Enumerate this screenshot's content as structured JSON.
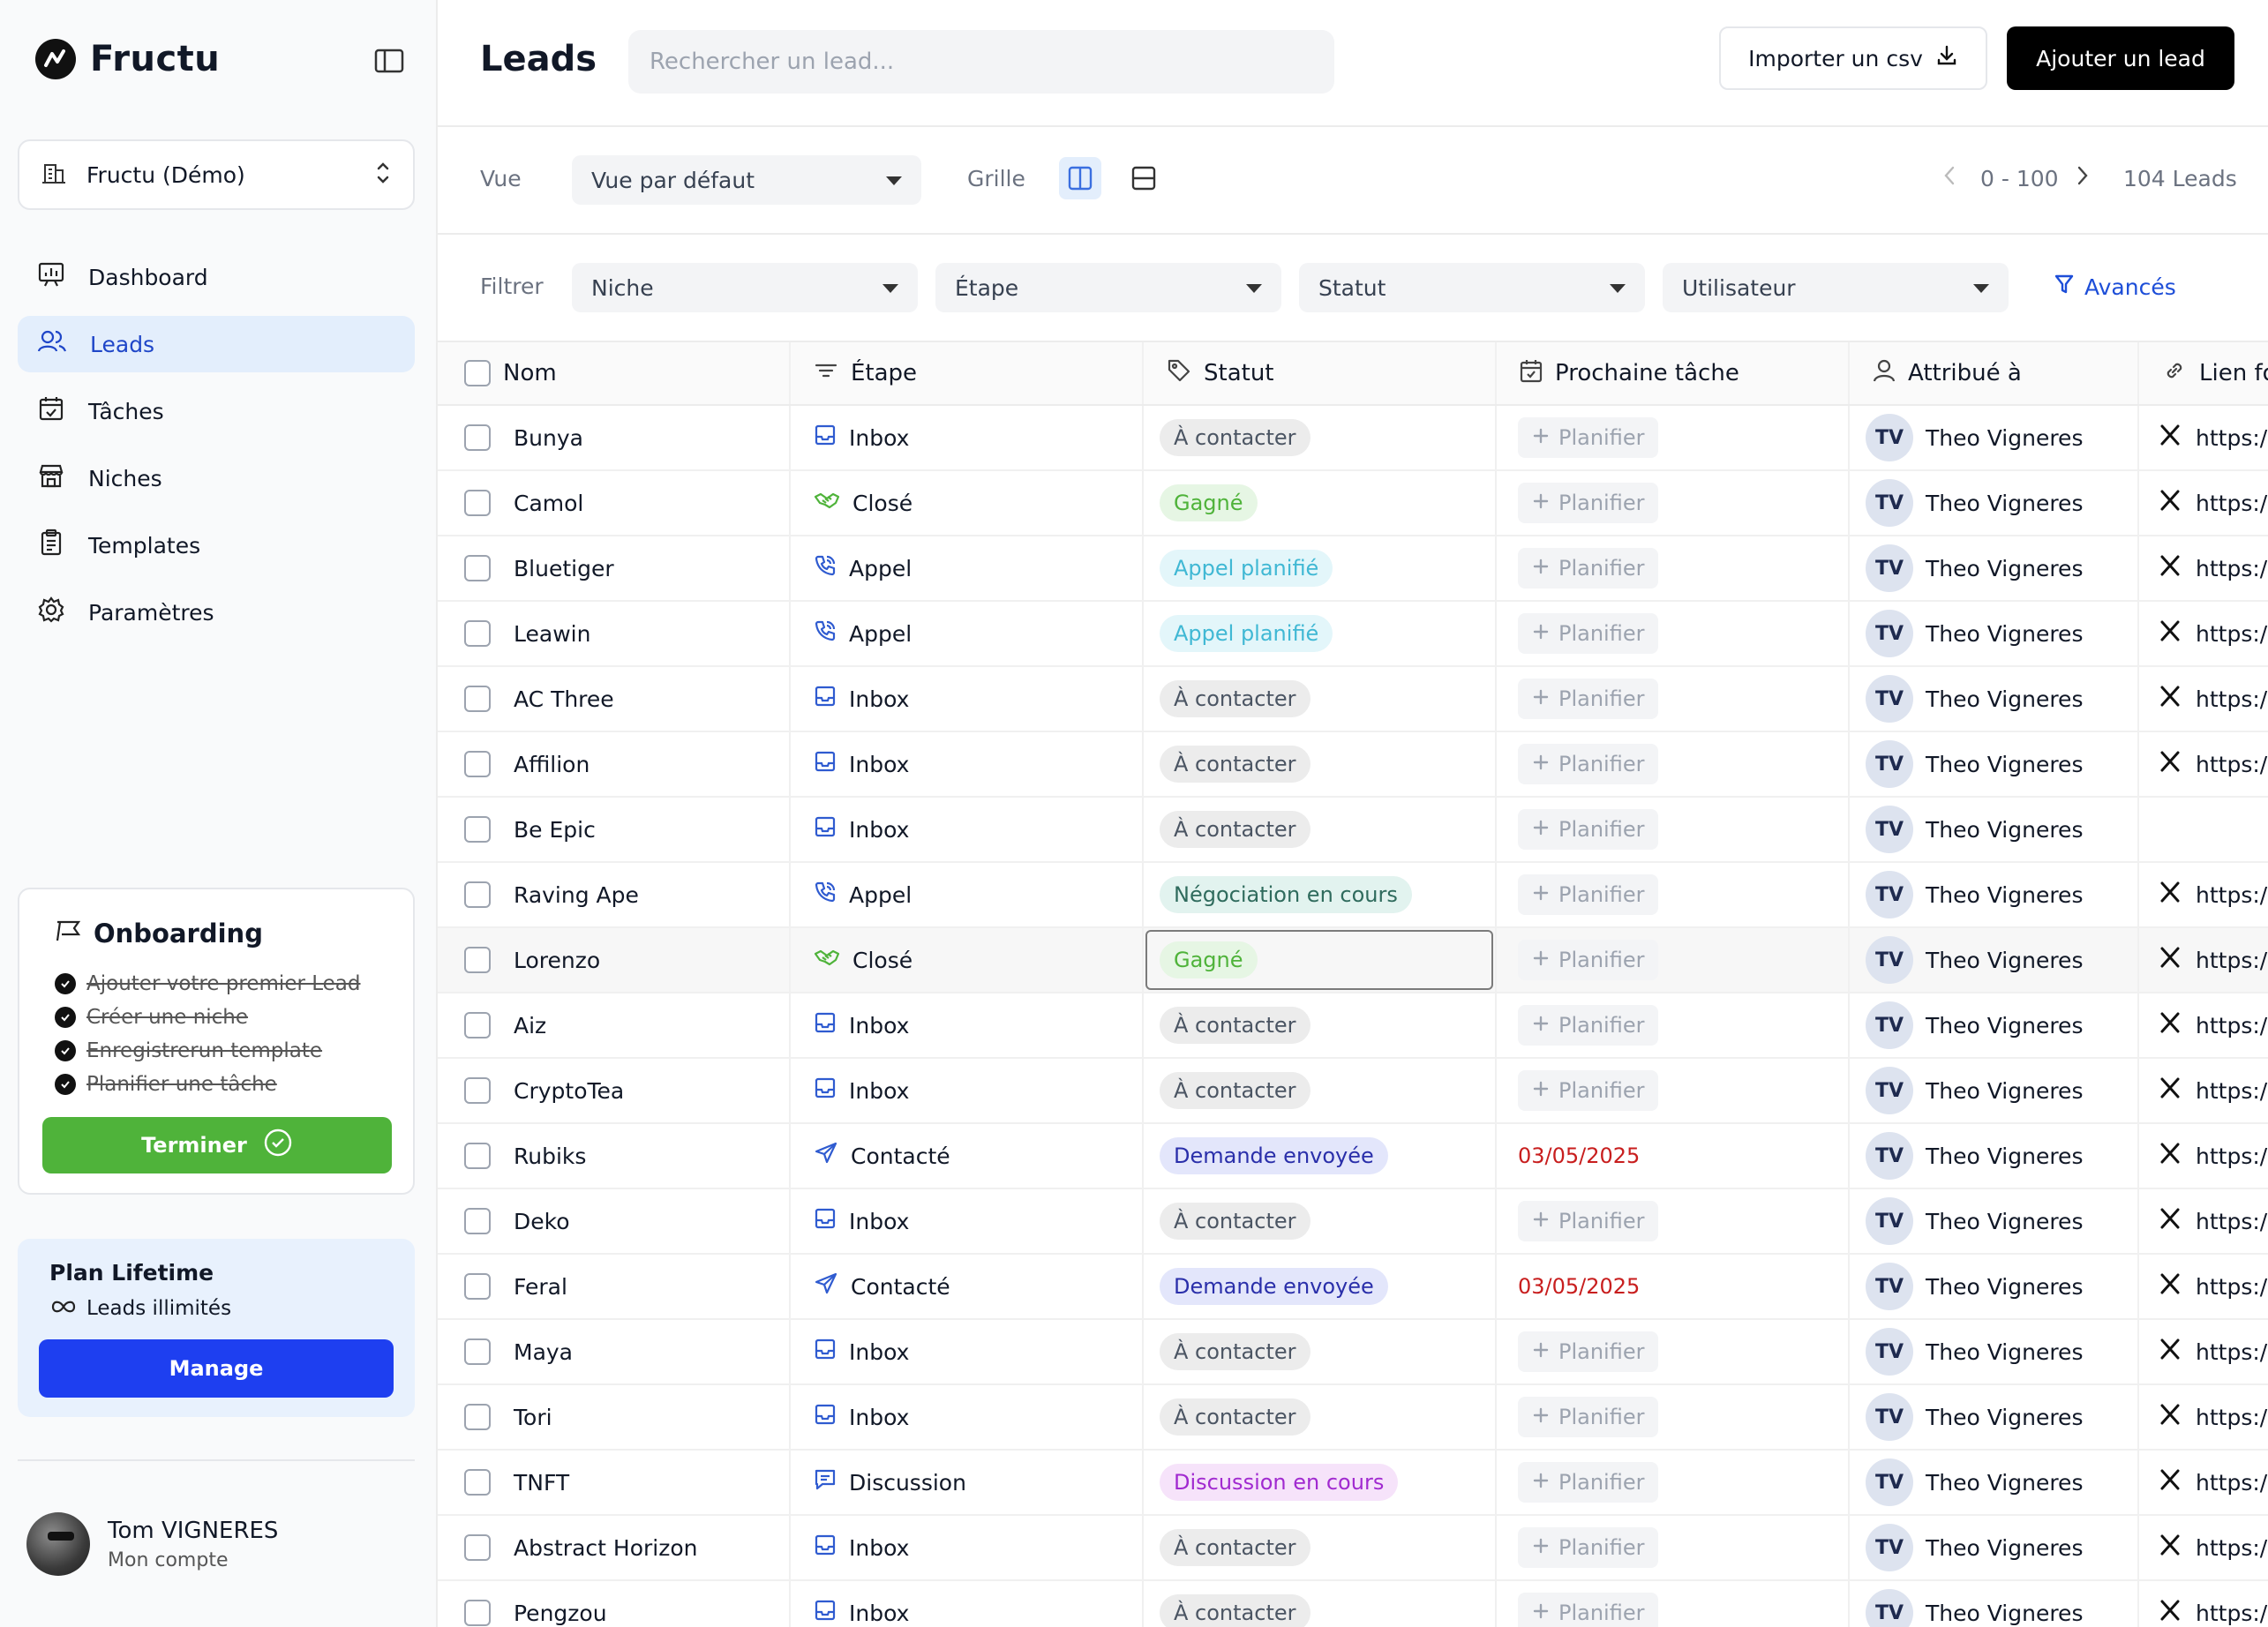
{
  "brand": {
    "name": "Fructu"
  },
  "workspace": {
    "name": "Fructu (Démo)"
  },
  "nav": [
    {
      "label": "Dashboard",
      "icon": "dashboard-icon",
      "active": false
    },
    {
      "label": "Leads",
      "icon": "users-icon",
      "active": true
    },
    {
      "label": "Tâches",
      "icon": "calendar-check-icon",
      "active": false
    },
    {
      "label": "Niches",
      "icon": "store-icon",
      "active": false
    },
    {
      "label": "Templates",
      "icon": "clipboard-icon",
      "active": false
    },
    {
      "label": "Paramètres",
      "icon": "gear-icon",
      "active": false
    }
  ],
  "onboarding": {
    "title": "Onboarding",
    "items": [
      "Ajouter votre premier Lead",
      "Créer une niche",
      "Enregistrerun template",
      "Planifier une tâche"
    ],
    "button": "Terminer"
  },
  "plan": {
    "title": "Plan Lifetime",
    "subtitle": "Leads illimités",
    "button": "Manage"
  },
  "account": {
    "name": "Tom VIGNERES",
    "subtitle": "Mon compte"
  },
  "header": {
    "title": "Leads",
    "search_placeholder": "Rechercher un lead...",
    "import_label": "Importer un csv",
    "add_label": "Ajouter un lead"
  },
  "viewbar": {
    "view_label": "Vue",
    "view_value": "Vue par défaut",
    "grid_label": "Grille",
    "range": "0 - 100",
    "total": "104 Leads"
  },
  "filters": {
    "label": "Filtrer",
    "niche": "Niche",
    "etape": "Étape",
    "statut": "Statut",
    "utilisateur": "Utilisateur",
    "advanced": "Avancés"
  },
  "table": {
    "columns": {
      "name": "Nom",
      "stage": "Étape",
      "status": "Statut",
      "task": "Prochaine tâche",
      "assigned": "Attribué à",
      "link": "Lien fo"
    },
    "plan_label": "Planifier",
    "rows": [
      {
        "name": "Bunya",
        "stage": "Inbox",
        "status": "À contacter",
        "task": "",
        "initials": "TV",
        "user": "Theo Vigneres",
        "link": "https:/"
      },
      {
        "name": "Camol",
        "stage": "Closé",
        "status": "Gagné",
        "task": "",
        "initials": "TV",
        "user": "Theo Vigneres",
        "link": "https:/"
      },
      {
        "name": "Bluetiger",
        "stage": "Appel",
        "status": "Appel planifié",
        "task": "",
        "initials": "TV",
        "user": "Theo Vigneres",
        "link": "https:/"
      },
      {
        "name": "Leawin",
        "stage": "Appel",
        "status": "Appel planifié",
        "task": "",
        "initials": "TV",
        "user": "Theo Vigneres",
        "link": "https:/"
      },
      {
        "name": "AC Three",
        "stage": "Inbox",
        "status": "À contacter",
        "task": "",
        "initials": "TV",
        "user": "Theo Vigneres",
        "link": "https:/"
      },
      {
        "name": "Affilion",
        "stage": "Inbox",
        "status": "À contacter",
        "task": "",
        "initials": "TV",
        "user": "Theo Vigneres",
        "link": "https:/"
      },
      {
        "name": "Be Epic",
        "stage": "Inbox",
        "status": "À contacter",
        "task": "",
        "initials": "TV",
        "user": "Theo Vigneres",
        "link": ""
      },
      {
        "name": "Raving Ape",
        "stage": "Appel",
        "status": "Négociation en cours",
        "task": "",
        "initials": "TV",
        "user": "Theo Vigneres",
        "link": "https:/"
      },
      {
        "name": "Lorenzo",
        "stage": "Closé",
        "status": "Gagné",
        "task": "",
        "initials": "TV",
        "user": "Theo Vigneres",
        "link": "https:/"
      },
      {
        "name": "Aiz",
        "stage": "Inbox",
        "status": "À contacter",
        "task": "",
        "initials": "TV",
        "user": "Theo Vigneres",
        "link": "https:/"
      },
      {
        "name": "CryptoTea",
        "stage": "Inbox",
        "status": "À contacter",
        "task": "",
        "initials": "TV",
        "user": "Theo Vigneres",
        "link": "https:/"
      },
      {
        "name": "Rubiks",
        "stage": "Contacté",
        "status": "Demande envoyée",
        "task": "03/05/2025",
        "initials": "TV",
        "user": "Theo Vigneres",
        "link": "https:/"
      },
      {
        "name": "Deko",
        "stage": "Inbox",
        "status": "À contacter",
        "task": "",
        "initials": "TV",
        "user": "Theo Vigneres",
        "link": "https:/"
      },
      {
        "name": "Feral",
        "stage": "Contacté",
        "status": "Demande envoyée",
        "task": "03/05/2025",
        "initials": "TV",
        "user": "Theo Vigneres",
        "link": "https:/"
      },
      {
        "name": "Maya",
        "stage": "Inbox",
        "status": "À contacter",
        "task": "",
        "initials": "TV",
        "user": "Theo Vigneres",
        "link": "https:/"
      },
      {
        "name": "Tori",
        "stage": "Inbox",
        "status": "À contacter",
        "task": "",
        "initials": "TV",
        "user": "Theo Vigneres",
        "link": "https:/"
      },
      {
        "name": "TNFT",
        "stage": "Discussion",
        "status": "Discussion en cours",
        "task": "",
        "initials": "TV",
        "user": "Theo Vigneres",
        "link": "https:/"
      },
      {
        "name": "Abstract Horizon",
        "stage": "Inbox",
        "status": "À contacter",
        "task": "",
        "initials": "TV",
        "user": "Theo Vigneres",
        "link": "https:/"
      },
      {
        "name": "Pengzou",
        "stage": "Inbox",
        "status": "À contacter",
        "task": "",
        "initials": "TV",
        "user": "Theo Vigneres",
        "link": "https:/"
      }
    ]
  },
  "colors": {
    "accent": "#1f46c8",
    "success": "#4fb33a",
    "manage": "#1e3ff0",
    "date": "#c81e1e"
  }
}
